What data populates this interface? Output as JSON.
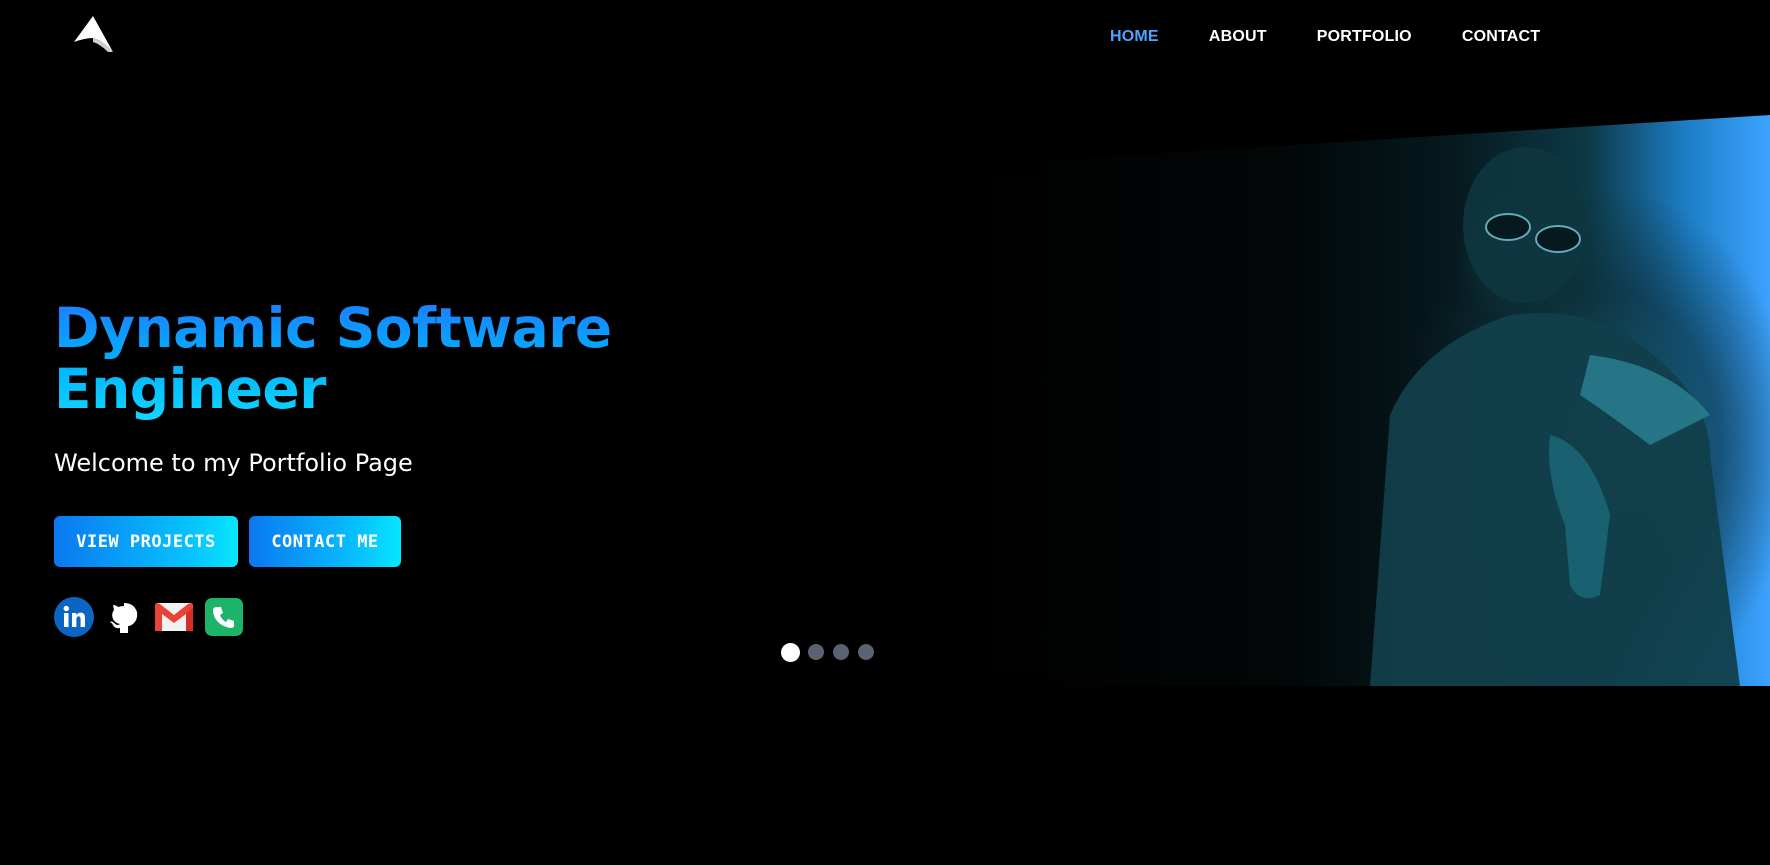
{
  "nav": {
    "items": [
      {
        "label": "HOME",
        "active": true
      },
      {
        "label": "ABOUT",
        "active": false
      },
      {
        "label": "PORTFOLIO",
        "active": false
      },
      {
        "label": "CONTACT",
        "active": false
      }
    ],
    "active_color": "#4da3ff"
  },
  "hero": {
    "title_line1": "Dynamic Software",
    "title_line2": "Engineer",
    "subtitle": "Welcome to my Portfolio Page",
    "buttons": {
      "view_projects": "VIEW PROJECTS",
      "contact_me": "CONTACT ME"
    },
    "gradient_colors": [
      "#0a78f0",
      "#08e6ff"
    ]
  },
  "socials": [
    {
      "icon": "linkedin-icon",
      "color": "#0a66c2"
    },
    {
      "icon": "github-icon",
      "color": "#ffffff"
    },
    {
      "icon": "gmail-icon",
      "color": "#ea4335"
    },
    {
      "icon": "phone-icon",
      "color": "#1db46a"
    }
  ],
  "carousel": {
    "slide_count": 4,
    "active_index": 0
  }
}
